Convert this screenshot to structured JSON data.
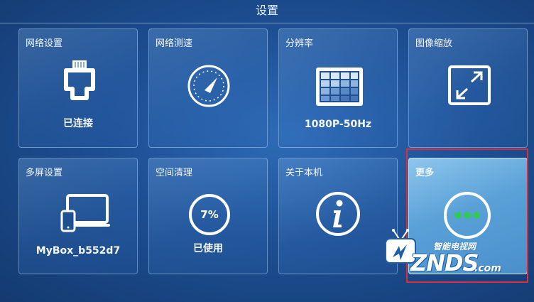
{
  "header": {
    "title": "设置"
  },
  "tiles": {
    "network": {
      "label": "网络设置",
      "status": "已连接",
      "icon": "ethernet-port-icon"
    },
    "speedtest": {
      "label": "网络测速",
      "icon": "speedometer-icon"
    },
    "resolution": {
      "label": "分辨率",
      "value": "1080P-50Hz",
      "icon": "resolution-grid-icon"
    },
    "zoom": {
      "label": "图像缩放",
      "icon": "expand-icon"
    },
    "multiscreen": {
      "label": "多屏设置",
      "device_name": "MyBox_b552d7",
      "icon": "multi-device-icon"
    },
    "storage": {
      "label": "空间清理",
      "percent": "7%",
      "percent_value": 7,
      "status": "已使用",
      "icon": "storage-ring-icon"
    },
    "about": {
      "label": "关于本机",
      "icon": "info-icon"
    },
    "more": {
      "label": "更多",
      "icon": "more-dots-icon",
      "selected": true
    }
  },
  "watermark": {
    "subtitle": "智能电视网",
    "brand": "ZNDS",
    "suffix": ".com"
  },
  "colors": {
    "highlight_border": "#d8303a",
    "dots": "#34c759",
    "selected_tile": "#5aa1d8"
  }
}
